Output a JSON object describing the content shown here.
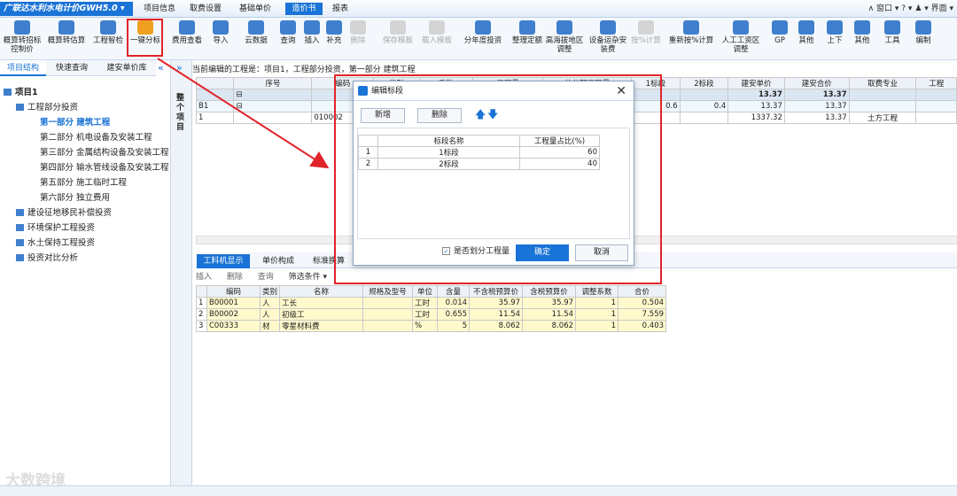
{
  "app_title": "广联达水利水电计价GWH5.0 ▾",
  "menu_tabs": [
    "项目信息",
    "取费设置",
    "基础单价",
    "造价书",
    "报表"
  ],
  "system_menu": "∧ 窗口 ▾  ?  ▾  ♟ ▾  界面 ▾",
  "ribbon": {
    "tools": [
      {
        "label": "概算转招标控制价",
        "color": "#3f7fce"
      },
      {
        "label": "概算转估算",
        "color": "#3f7fce"
      },
      {
        "label": "工程智检",
        "color": "#3f7fce"
      },
      {
        "label": "一键分标",
        "color": "#f0a020"
      },
      {
        "label": "费用查看",
        "color": "#3f7fce"
      },
      {
        "label": "导入",
        "color": "#3f7fce"
      },
      {
        "label": "云数据",
        "color": "#3f7fce"
      },
      {
        "label": "查询",
        "color": "#3f7fce"
      },
      {
        "label": "插入",
        "color": "#3f7fce"
      },
      {
        "label": "补充",
        "color": "#3f7fce"
      },
      {
        "label": "删除",
        "color": "#3f7fce",
        "disabled": true
      },
      {
        "label": "保存模板",
        "color": "#3f7fce",
        "disabled": true
      },
      {
        "label": "载入模板",
        "color": "#3f7fce",
        "disabled": true
      },
      {
        "label": "分年度投资",
        "color": "#3f7fce"
      },
      {
        "label": "整理定额",
        "color": "#3f7fce"
      },
      {
        "label": "高海拔地区调整",
        "color": "#3f7fce"
      },
      {
        "label": "设备运杂安装费",
        "color": "#3f7fce"
      },
      {
        "label": "按%计算",
        "color": "#3f7fce",
        "disabled": true
      },
      {
        "label": "重新按%计算",
        "color": "#3f7fce"
      },
      {
        "label": "人工工资区调整",
        "color": "#3f7fce"
      },
      {
        "label": "GP",
        "color": "#3f7fce"
      },
      {
        "label": "其他",
        "color": "#3f7fce"
      },
      {
        "label": "上下",
        "color": "#3f7fce"
      },
      {
        "label": "其他",
        "color": "#3f7fce"
      },
      {
        "label": "工具",
        "color": "#3f7fce"
      },
      {
        "label": "编制",
        "color": "#3f7fce"
      }
    ]
  },
  "left_tabs": [
    "项目结构",
    "快速查询",
    "建安单价库"
  ],
  "tree": [
    {
      "label": "项目1",
      "level": 0,
      "bold": true
    },
    {
      "label": "工程部分投资",
      "level": 1
    },
    {
      "label": "第一部分  建筑工程",
      "level": 2,
      "selected": true
    },
    {
      "label": "第二部分  机电设备及安装工程",
      "level": 2
    },
    {
      "label": "第三部分  金属结构设备及安装工程",
      "level": 2
    },
    {
      "label": "第四部分  输水管线设备及安装工程",
      "level": 2
    },
    {
      "label": "第五部分  施工临时工程",
      "level": 2
    },
    {
      "label": "第六部分  独立费用",
      "level": 2
    },
    {
      "label": "建设征地移民补偿投资",
      "level": 1
    },
    {
      "label": "环境保护工程投资",
      "level": 1
    },
    {
      "label": "水土保持工程投资",
      "level": 1
    },
    {
      "label": "投资对比分析",
      "level": 1
    }
  ],
  "vstrip_label": "整个项目",
  "current_path": "当前编辑的工程是：项目1，工程部分投资，第一部分 建筑工程",
  "grid": {
    "headers": [
      "序号",
      "编码",
      "类别",
      "",
      "工程量",
      "待分配工程量",
      "1标段",
      "2标段",
      "建安单价",
      "建安合价",
      "取费专业",
      "工程"
    ],
    "rows": [
      [
        "",
        "",
        "",
        "",
        "",
        "",
        "",
        "",
        "13.37",
        "13.37",
        "",
        ""
      ],
      [
        "B1",
        "",
        "项",
        "土",
        "1",
        "0",
        "0.6",
        "0.4",
        "13.37",
        "13.37",
        "",
        ""
      ],
      [
        "1",
        "010002",
        "定",
        "人",
        "1",
        "",
        "",
        "",
        "1337.32",
        "13.37",
        "土方工程",
        ""
      ]
    ],
    "extra_col_header": "系数"
  },
  "bottom_tabs": [
    "工料机显示",
    "单价构成",
    "标准换算"
  ],
  "bottom_toolbar": [
    "插入",
    "删除",
    "查询",
    "筛选条件 ▾"
  ],
  "sub_table": {
    "headers": [
      "",
      "编码",
      "类别",
      "名称",
      "规格及型号",
      "单位",
      "含量",
      "不含税预算价",
      "含税预算价",
      "调整系数",
      "合价"
    ],
    "rows": [
      [
        "1",
        "B00001",
        "人",
        "工长",
        "",
        "工时",
        "0.014",
        "35.97",
        "35.97",
        "1",
        "0.504"
      ],
      [
        "2",
        "B00002",
        "人",
        "初级工",
        "",
        "工时",
        "0.655",
        "11.54",
        "11.54",
        "1",
        "7.559"
      ],
      [
        "3",
        "C00333",
        "材",
        "零星材料费",
        "",
        "%",
        "5",
        "8.062",
        "8.062",
        "1",
        "0.403"
      ]
    ]
  },
  "dialog": {
    "title": "编辑标段",
    "add_label": "新增",
    "delete_label": "删除",
    "table_headers": [
      "",
      "标段名称",
      "工程量占比(%)"
    ],
    "rows": [
      [
        "1",
        "1标段",
        "60"
      ],
      [
        "2",
        "2标段",
        "40"
      ]
    ],
    "checkbox_label": "是否划分工程量",
    "confirm_label": "确定",
    "cancel_label": "取消"
  },
  "watermark": "大数跨境",
  "accent_color": "#1a73d6",
  "highlight_color": "#e0242a"
}
